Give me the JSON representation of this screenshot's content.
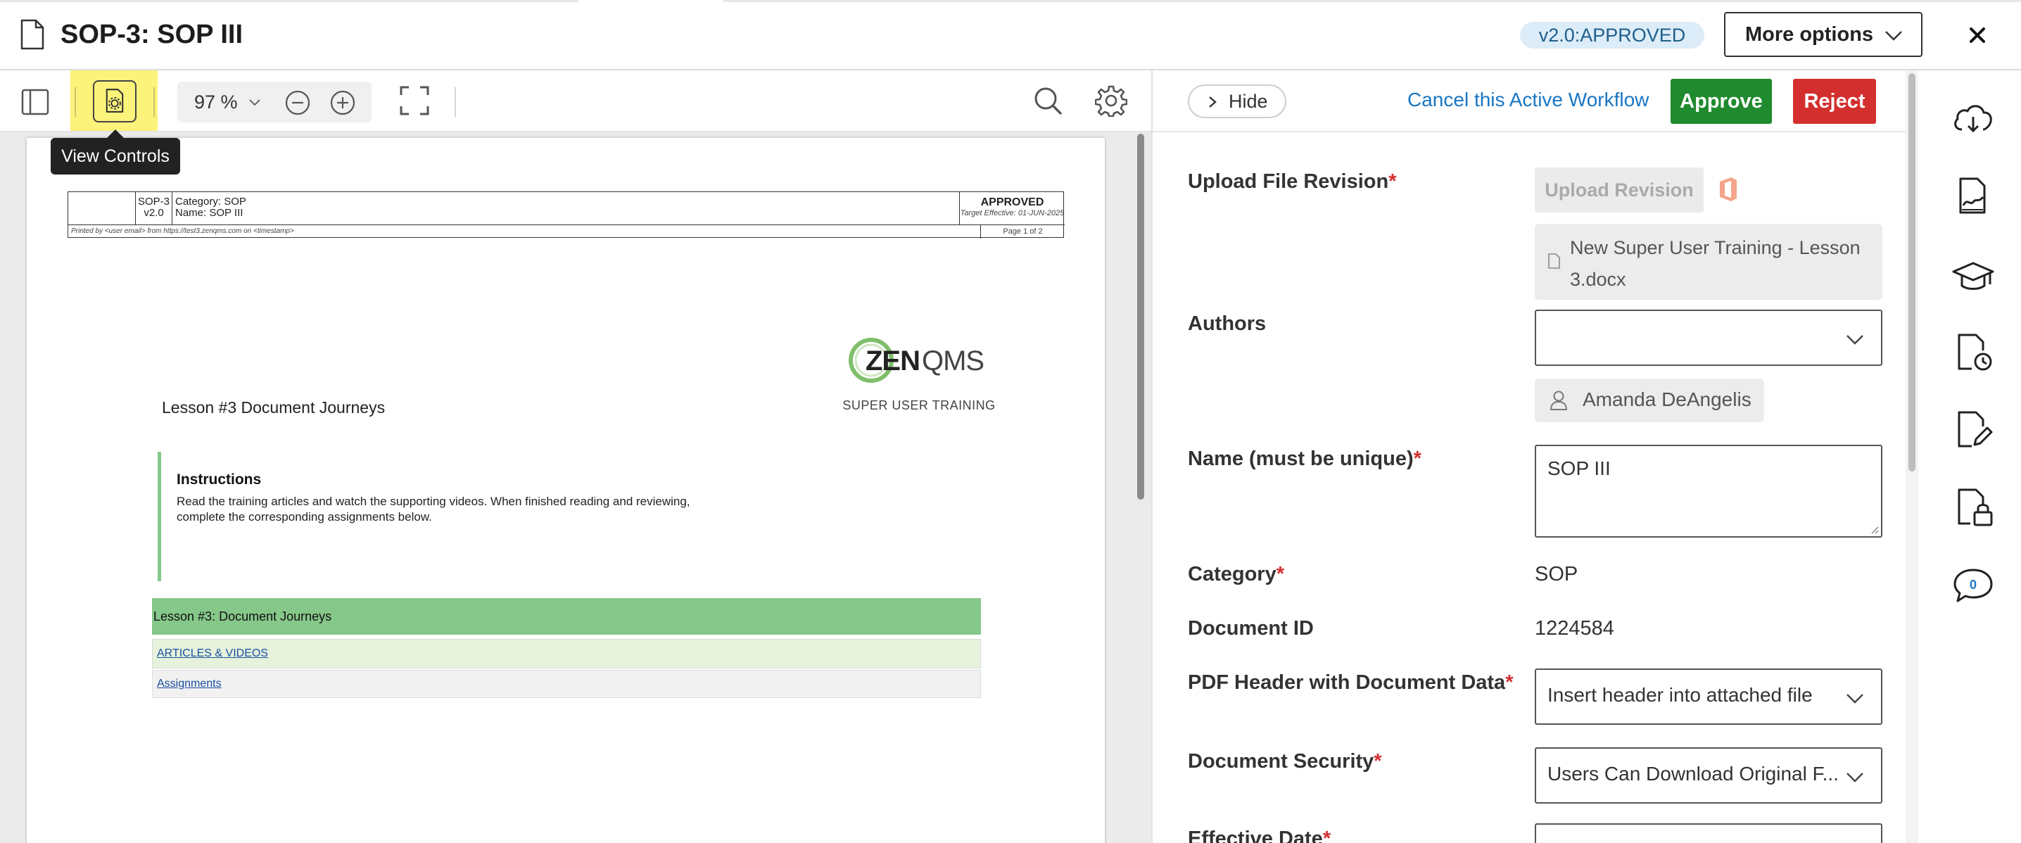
{
  "header": {
    "title": "SOP-3: SOP III",
    "version_status": "v2.0:APPROVED",
    "more_options_label": "More options"
  },
  "viewer_toolbar": {
    "zoom_value": "97 %",
    "tooltip": "View Controls"
  },
  "document": {
    "header_table": {
      "doc_number": "SOP-3",
      "doc_version": "v2.0",
      "category_line": "Category: SOP",
      "name_line": "Name: SOP III",
      "status": "APPROVED",
      "target_effective": "Target Effective: 01-JUN-2025",
      "printed_by": "Printed by <user email> from https://test3.zenqms.com on <timestamp>",
      "page_info": "Page 1 of 2"
    },
    "logo_text": "ZENQMS",
    "logo_tagline": "SUPER USER TRAINING",
    "lesson_title": "Lesson #3 Document Journeys",
    "instructions_heading": "Instructions",
    "instructions_body": "Read the training articles and watch the supporting videos. When finished reading and reviewing, complete the corresponding assignments below.",
    "lesson_bar": "Lesson #3: Document Journeys",
    "articles_link": "ARTICLES & VIDEOS",
    "assignments_link": "Assignments"
  },
  "panel": {
    "hide_label": "Hide",
    "cancel_workflow_label": "Cancel this Active Workflow",
    "approve_label": "Approve",
    "reject_label": "Reject",
    "upload_label": "Upload File Revision",
    "upload_button": "Upload Revision",
    "file_name": "New Super User Training - Lesson 3.docx",
    "authors_label": "Authors",
    "authors_selected": "",
    "author_chip": "Amanda DeAngelis",
    "name_label": "Name (must be unique)",
    "name_value": "SOP III",
    "category_label": "Category",
    "category_value": "SOP",
    "docid_label": "Document ID",
    "docid_value": "1224584",
    "pdf_header_label": "PDF Header with Document Data",
    "pdf_header_value": "Insert header into attached file",
    "security_label": "Document Security",
    "security_value": "Users Can Download Original F...",
    "effective_date_label": "Effective Date",
    "required_mark": "*"
  },
  "rail": {
    "chat_count": "0"
  },
  "colors": {
    "approve": "#1f8a2e",
    "reject": "#d32f2f",
    "link": "#1976c4",
    "highlight": "#fbf37a",
    "lesson_green": "#86c88a"
  }
}
